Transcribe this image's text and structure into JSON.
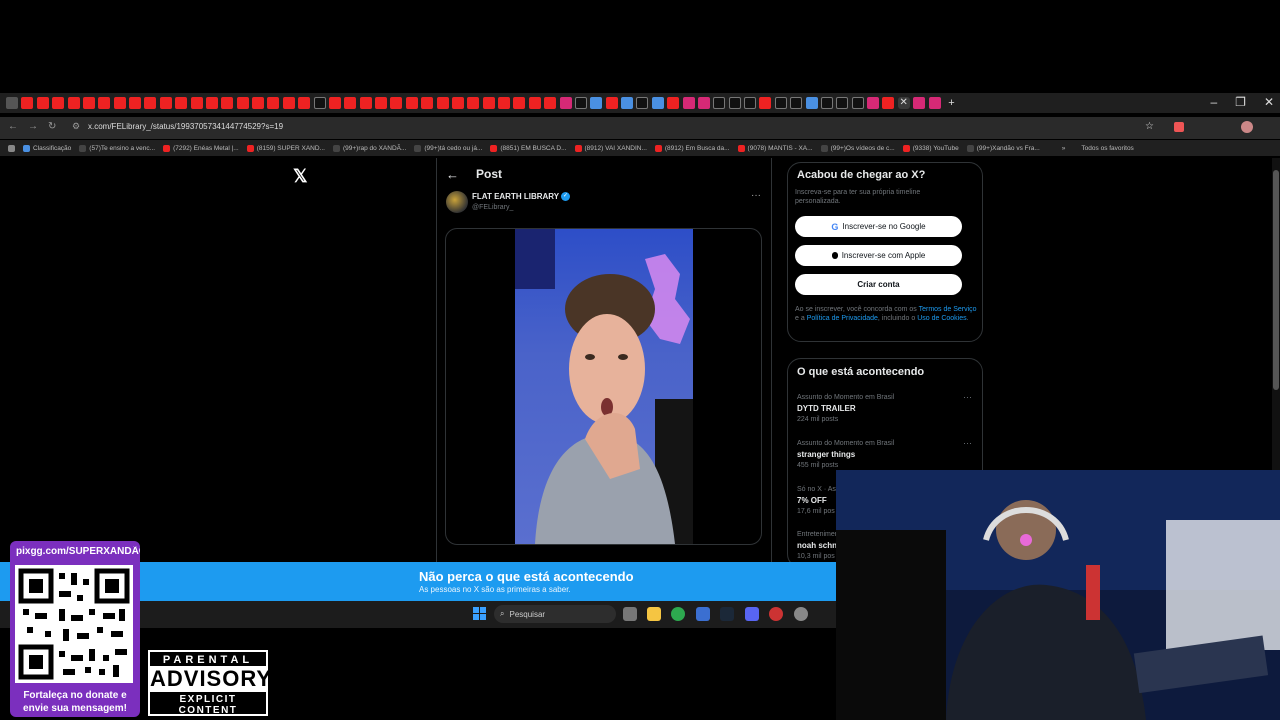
{
  "browser": {
    "url": "x.com/FELibrary_/status/1993705734144774529?s=19",
    "tab_icons": [
      "yt",
      "yt",
      "yt",
      "yt",
      "yt",
      "yt",
      "yt",
      "yt",
      "yt",
      "yt",
      "yt",
      "yt",
      "yt",
      "yt",
      "yt",
      "yt",
      "yt",
      "yt",
      "yt",
      "tt",
      "yt",
      "yt",
      "yt",
      "yt",
      "yt",
      "yt",
      "yt",
      "yt",
      "yt",
      "yt",
      "yt",
      "yt",
      "yt",
      "yt",
      "yt",
      "ig",
      "tt",
      "other",
      "yt",
      "other",
      "tt",
      "other",
      "yt",
      "ig",
      "ig",
      "tt",
      "tt",
      "tt",
      "yt",
      "tt",
      "tt",
      "other",
      "tt",
      "tt",
      "tt",
      "ig",
      "yt",
      "active",
      "ig",
      "ig"
    ],
    "active_tab_close": "✕",
    "new_tab": "+",
    "window_controls": [
      "–",
      "❐",
      "✕"
    ],
    "bookmarks": [
      {
        "label": "Classificação",
        "color": "#4a90e2"
      },
      {
        "label": "(57)Te ensino a venc...",
        "color": "#444"
      },
      {
        "label": "(7292) Enéas Metal |...",
        "color": "#e22"
      },
      {
        "label": "(8159) SUPER XAND...",
        "color": "#e22"
      },
      {
        "label": "(99+)rap do XANDÃ...",
        "color": "#444"
      },
      {
        "label": "(99+)tá cedo ou já...",
        "color": "#444"
      },
      {
        "label": "(8851) EM BUSCA D...",
        "color": "#e22"
      },
      {
        "label": "(8912) VAI XANDIN...",
        "color": "#e22"
      },
      {
        "label": "(8912) Em Busca da...",
        "color": "#e22"
      },
      {
        "label": "(9078) MANTIS - XA...",
        "color": "#e22"
      },
      {
        "label": "(99+)Os vídeos de c...",
        "color": "#444"
      },
      {
        "label": "(9338) YouTube",
        "color": "#e22"
      },
      {
        "label": "(99+)Xandão vs Fra...",
        "color": "#444"
      }
    ],
    "bookmarks_more": "»",
    "all_favorites": "Todos os favoritos"
  },
  "x": {
    "logo": "𝕏",
    "back": "←",
    "post_title": "Post",
    "author_name": "FLAT EARTH LIBRARY",
    "verified": "✓",
    "author_handle": "@FELibrary_",
    "more": "···"
  },
  "join": {
    "title": "Acabou de chegar ao X?",
    "subtitle": "Inscreva-se para ter sua própria timeline personalizada.",
    "google_label": "Inscrever-se no Google",
    "apple_label": "Inscrever-se com Apple",
    "create_label": "Criar conta",
    "terms_prefix": "Ao se inscrever, você concorda com os ",
    "terms_link1": "Termos de Serviço",
    "terms_mid1": " e a ",
    "terms_link2": "Política de Privacidade",
    "terms_mid2": ", incluindo o ",
    "terms_link3": "Uso de Cookies",
    "terms_end": "."
  },
  "trends": {
    "title": "O que está acontecendo",
    "items": [
      {
        "context": "Assunto do Momento em Brasil",
        "name": "DYTD TRAILER",
        "count": "224 mil posts"
      },
      {
        "context": "Assunto do Momento em Brasil",
        "name": "stranger things",
        "count": "455 mil posts"
      },
      {
        "context": "Só no X · As",
        "name": "7% OFF",
        "count": "17,6 mil pos"
      },
      {
        "context": "Entretenimen",
        "name": "noah schn",
        "count": "10,3 mil pos"
      }
    ],
    "more": "···"
  },
  "banner": {
    "title": "Não perca o que está acontecendo",
    "subtitle": "As pessoas no X são as primeiras a saber."
  },
  "taskbar": {
    "search_label": "Pesquisar"
  },
  "overlay": {
    "qr_url": "pixgg.com/SUPERXANDÃO",
    "qr_caption": "Fortaleça no donate e envie sua mensagem!",
    "advisory_top": "PARENTAL",
    "advisory_mid": "ADVISORY",
    "advisory_bot": "EXPLICIT CONTENT"
  }
}
